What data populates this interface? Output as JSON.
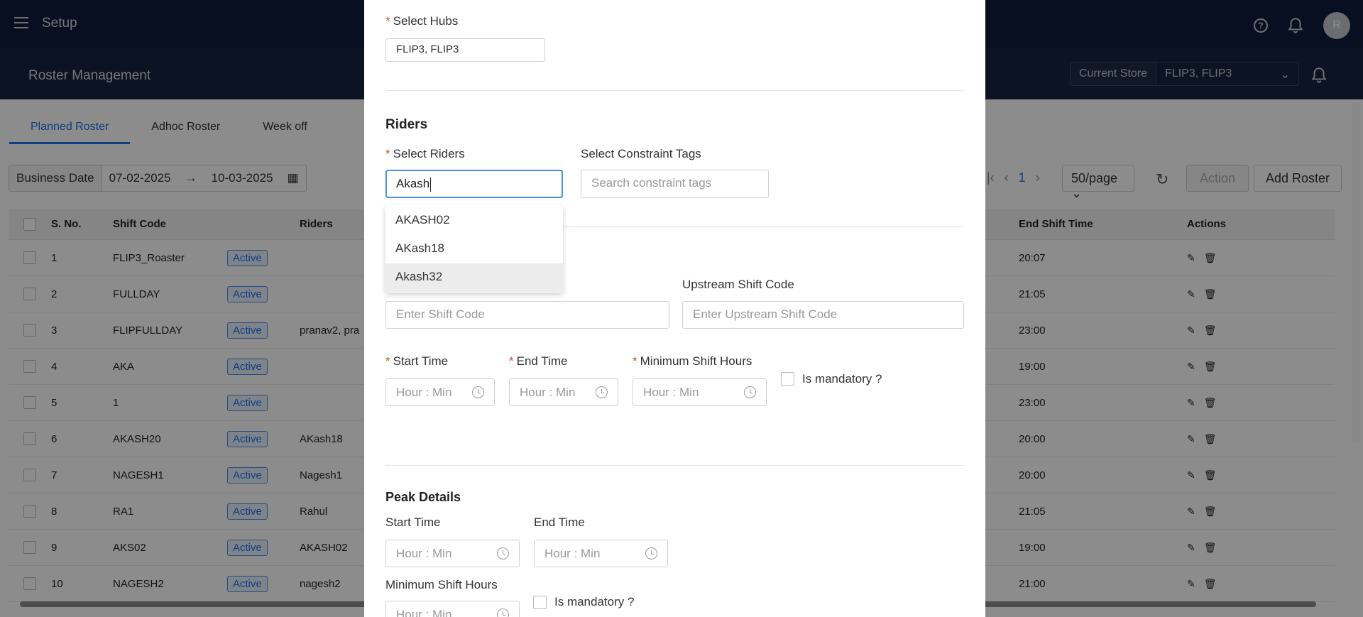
{
  "app": {
    "title": "Setup",
    "avatar_initial": "R"
  },
  "page": {
    "title": "Roster Management"
  },
  "store": {
    "label": "Current Store",
    "value": "FLIP3, FLIP3"
  },
  "tabs": [
    "Planned Roster",
    "Adhoc Roster",
    "Week off"
  ],
  "filter": {
    "label": "Business Date",
    "start": "07-02-2025",
    "arrow": "→",
    "end": "10-03-2025"
  },
  "pager": {
    "current": "1",
    "per_page": "50/page",
    "action": "Action",
    "add": "Add Roster"
  },
  "table": {
    "headers": {
      "sno": "S. No.",
      "code": "Shift Code",
      "riders": "Riders",
      "end": "End Shift Time",
      "actions": "Actions"
    },
    "rows": [
      {
        "sno": "1",
        "code": "FLIP3_Roaster",
        "status": "Active",
        "riders": "",
        "end": "20:07"
      },
      {
        "sno": "2",
        "code": "FULLDAY",
        "status": "Active",
        "riders": "",
        "end": "21:05"
      },
      {
        "sno": "3",
        "code": "FLIPFULLDAY",
        "status": "Active",
        "riders": "pranav2, pra",
        "end": "23:00"
      },
      {
        "sno": "4",
        "code": "AKA",
        "status": "Active",
        "riders": "",
        "end": "19:00"
      },
      {
        "sno": "5",
        "code": "1",
        "status": "Active",
        "riders": "",
        "end": "23:00"
      },
      {
        "sno": "6",
        "code": "AKASH20",
        "status": "Active",
        "riders": "AKash18",
        "end": "20:00"
      },
      {
        "sno": "7",
        "code": "NAGESH1",
        "status": "Active",
        "riders": "Nagesh1",
        "end": "20:00"
      },
      {
        "sno": "8",
        "code": "RA1",
        "status": "Active",
        "riders": "Rahul",
        "end": "21:05"
      },
      {
        "sno": "9",
        "code": "AKS02",
        "status": "Active",
        "riders": "AKASH02",
        "end": "19:00"
      },
      {
        "sno": "10",
        "code": "NAGESH2",
        "status": "Active",
        "riders": "nagesh2",
        "end": "21:00"
      }
    ]
  },
  "modal": {
    "hubs_label": "Select Hubs",
    "hubs_value": "FLIP3, FLIP3",
    "riders_title": "Riders",
    "riders_label": "Select Riders",
    "riders_value": "Akash",
    "tags_label": "Select Constraint Tags",
    "tags_placeholder": "Search constraint tags",
    "rider_options": [
      "AKASH02",
      "AKash18",
      "Akash32"
    ],
    "upstream_label": "Upstream Shift Code",
    "shift_code_placeholder": "Enter Shift Code",
    "upstream_placeholder": "Enter Upstream Shift Code",
    "start_label": "Start Time",
    "end_label": "End Time",
    "min_hours_label": "Minimum Shift Hours",
    "time_placeholder": "Hour : Min",
    "mandatory_label": "Is mandatory ?",
    "peak_title": "Peak Details",
    "peak_start_label": "Start Time",
    "peak_end_label": "End Time",
    "peak_min_label": "Minimum Shift Hours",
    "peak_mandatory_label": "Is mandatory ?"
  }
}
